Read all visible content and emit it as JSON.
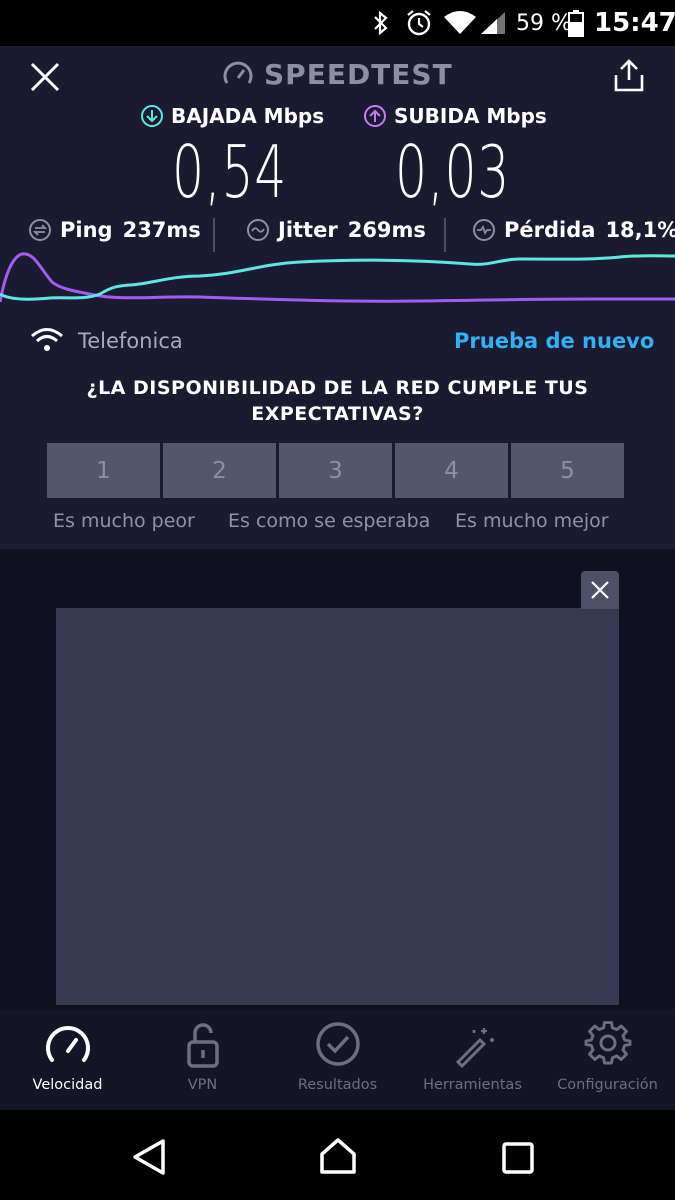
{
  "status_bar": {
    "battery": "59 %",
    "time": "15:47"
  },
  "header": {
    "title": "SPEEDTEST"
  },
  "speeds": {
    "download_label": "BAJADA Mbps",
    "download_value": "0,54",
    "upload_label": "SUBIDA Mbps",
    "upload_value": "0,03"
  },
  "metrics": {
    "ping_label": "Ping",
    "ping_value": "237ms",
    "jitter_label": "Jitter",
    "jitter_value": "269ms",
    "loss_label": "Pérdida",
    "loss_value": "18,1%"
  },
  "colors": {
    "download": "#5ee6e0",
    "upload": "#a35cf0",
    "accent": "#2fb3f5"
  },
  "network": {
    "provider": "Telefonica",
    "retry_label": "Prueba de nuevo"
  },
  "survey": {
    "question": "¿LA DISPONIBILIDAD DE LA RED CUMPLE TUS EXPECTATIVAS?",
    "options": [
      "1",
      "2",
      "3",
      "4",
      "5"
    ],
    "caption_left": "Es mucho peor",
    "caption_mid": "Es como se esperaba",
    "caption_right": "Es mucho mejor"
  },
  "nav": {
    "items": [
      {
        "label": "Velocidad",
        "icon": "speedometer-icon",
        "active": true
      },
      {
        "label": "VPN",
        "icon": "lock-icon",
        "active": false
      },
      {
        "label": "Resultados",
        "icon": "checkmark-circle-icon",
        "active": false
      },
      {
        "label": "Herramientas",
        "icon": "magic-wand-icon",
        "active": false
      },
      {
        "label": "Configuración",
        "icon": "gear-icon",
        "active": false
      }
    ]
  }
}
